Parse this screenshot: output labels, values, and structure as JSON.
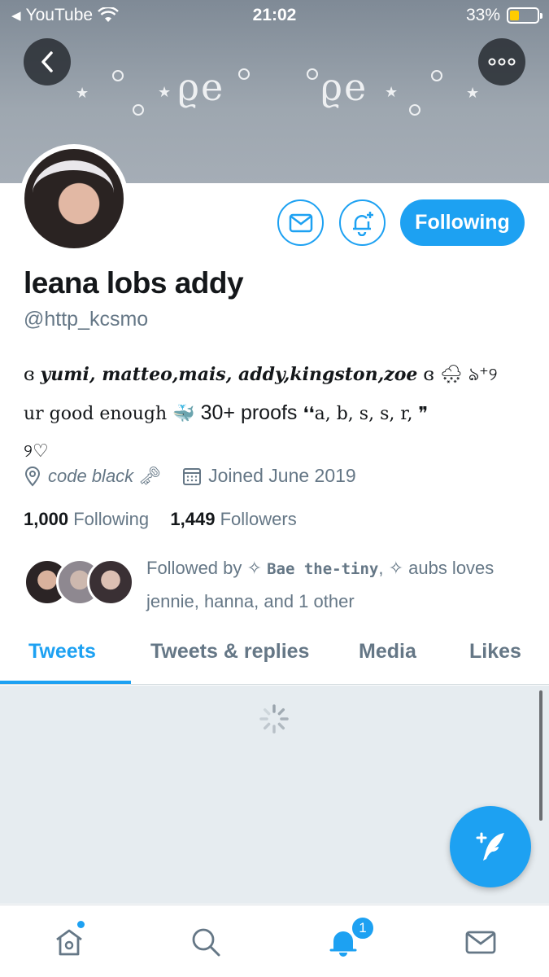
{
  "status_bar": {
    "back_app": "YouTube",
    "time": "21:02",
    "battery_percent": "33%",
    "battery_level": 0.33
  },
  "header": {
    "decoration_left": "°•⁎ᑫ℮°",
    "decoration_right": "°ᑫ℮⁎•°"
  },
  "profile": {
    "name": "leana lobs addy",
    "handle": "@http_kcsmo",
    "follow_button_label": "Following",
    "bio": {
      "line1_names": "yumi, matteo,mais, addy,kingston,zoe",
      "line1_open": "ɞ",
      "line1_close": "ɞ",
      "line1_tail": "ঌ⁺୨",
      "line2_text": "ur good enough",
      "line2_proofs": "30+ proofs",
      "line2_quote": "❛❛a, b, s, s, r, ❞",
      "line3": "୨♡"
    },
    "location": "code black",
    "joined": "Joined June 2019",
    "following_count": "1,000",
    "following_label": "Following",
    "followers_count": "1,449",
    "followers_label": "Followers",
    "followed_by": {
      "prefix": "Followed by ✧",
      "name1": "Bae the-tiny",
      "rest": ", ✧ aubs loves jennie, hanna, and 1 other"
    }
  },
  "tabs": [
    {
      "label": "Tweets",
      "active": true
    },
    {
      "label": "Tweets & replies",
      "active": false
    },
    {
      "label": "Media",
      "active": false
    },
    {
      "label": "Likes",
      "active": false
    }
  ],
  "bottom_nav": {
    "notifications_badge": "1",
    "items": [
      "home-icon",
      "search-icon",
      "bell-icon",
      "mail-icon"
    ]
  },
  "colors": {
    "accent": "#1da1f2",
    "secondary_text": "#657786",
    "content_bg": "#e6ecf0"
  }
}
